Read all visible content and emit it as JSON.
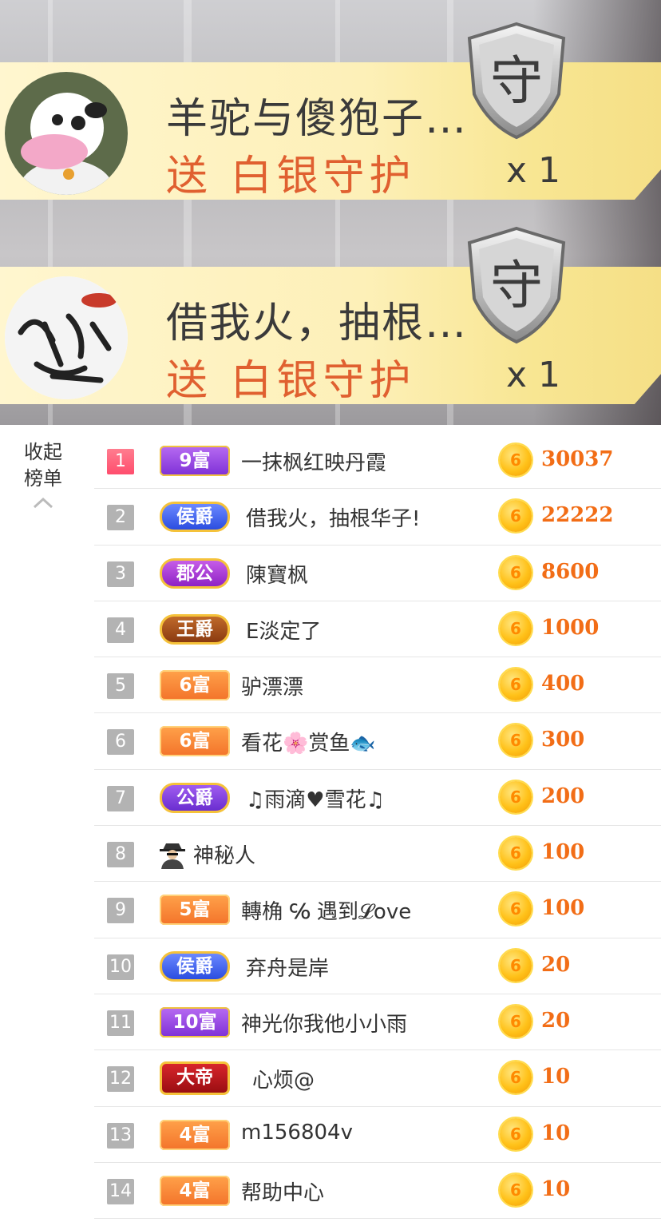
{
  "gift_banners": [
    {
      "sender": "羊驼与傻狍子…",
      "gift": "送 白银守护",
      "shield_label": "守",
      "count": "x 1",
      "avatar_icon": "cartoon-cow-avatar"
    },
    {
      "sender": "借我火，抽根…",
      "gift": "送 白银守护",
      "shield_label": "守",
      "count": "x 1",
      "avatar_icon": "calligraphy-avatar"
    }
  ],
  "collapse": {
    "line1": "收起",
    "line2": "榜单",
    "icon": "chevron-up-icon"
  },
  "ranking": [
    {
      "rank": "1",
      "badge": "9富",
      "badge_type": "rich-purple",
      "name": "一抹枫红映丹霞",
      "amount": "30037"
    },
    {
      "rank": "2",
      "badge": "侯爵",
      "badge_type": "noble blue",
      "name": "借我火，抽根华子!",
      "amount": "22222"
    },
    {
      "rank": "3",
      "badge": "郡公",
      "badge_type": "noble violet",
      "name": "陳寶枫",
      "amount": "8600"
    },
    {
      "rank": "4",
      "badge": "王爵",
      "badge_type": "noble brown",
      "name": "E淡定了",
      "amount": "1000"
    },
    {
      "rank": "5",
      "badge": "6富",
      "badge_type": "rich-orange",
      "name": "驴漂漂",
      "amount": "400"
    },
    {
      "rank": "6",
      "badge": "6富",
      "badge_type": "rich-orange",
      "name": "看花🌸赏鱼🐟",
      "amount": "300"
    },
    {
      "rank": "7",
      "badge": "公爵",
      "badge_type": "noble purple",
      "name": "♫雨滴♥雪花♫",
      "amount": "200"
    },
    {
      "rank": "8",
      "badge": "",
      "badge_type": "mystery",
      "name": "神秘人",
      "amount": "100"
    },
    {
      "rank": "9",
      "badge": "5富",
      "badge_type": "rich-orange",
      "name": "轉桷 ℅ 遇到𝓛ove",
      "amount": "100"
    },
    {
      "rank": "10",
      "badge": "侯爵",
      "badge_type": "noble blue",
      "name": "弃舟是岸",
      "amount": "20"
    },
    {
      "rank": "11",
      "badge": "10富",
      "badge_type": "rich-purple",
      "name": "神光你我他小小雨",
      "amount": "20"
    },
    {
      "rank": "12",
      "badge": "大帝",
      "badge_type": "emperor",
      "name": "心烦@",
      "amount": "10"
    },
    {
      "rank": "13",
      "badge": "4富",
      "badge_type": "rich-orange",
      "name": "m156804v",
      "amount": "10"
    },
    {
      "rank": "14",
      "badge": "4富",
      "badge_type": "rich-orange",
      "name": "帮助中心",
      "amount": "10"
    }
  ],
  "coin_icon": {
    "name": "coin-icon",
    "glyph": "6"
  },
  "colors": {
    "amount": "#f26d16",
    "gift_text": "#e06030",
    "first_rank": "#ff4d6d",
    "rank_gray": "#b3b3b3"
  }
}
